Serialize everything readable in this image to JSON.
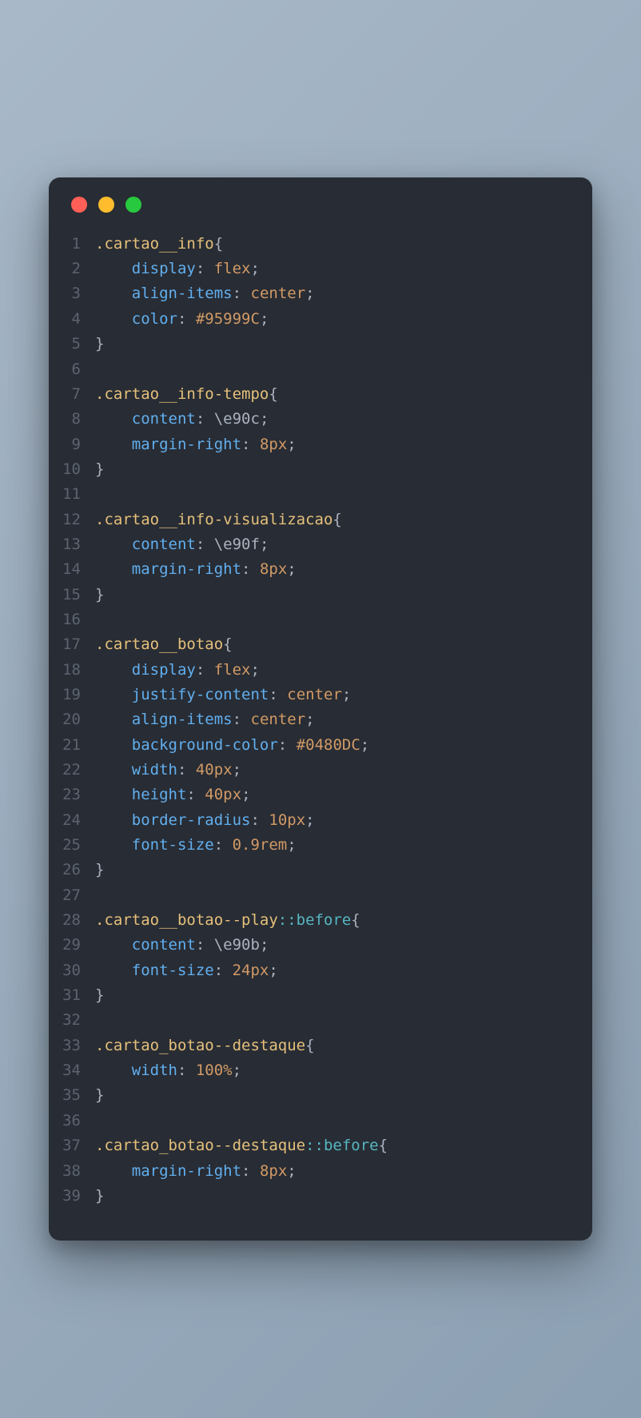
{
  "window": {
    "dots": [
      "red",
      "yellow",
      "green"
    ]
  },
  "lines": [
    {
      "n": "1",
      "i": 0,
      "t": [
        {
          "c": "sel",
          "s": ".cartao__info"
        },
        {
          "c": "punc",
          "s": "{"
        }
      ]
    },
    {
      "n": "2",
      "i": 1,
      "t": [
        {
          "c": "prop",
          "s": "display"
        },
        {
          "c": "punc",
          "s": ": "
        },
        {
          "c": "val",
          "s": "flex"
        },
        {
          "c": "punc",
          "s": ";"
        }
      ]
    },
    {
      "n": "3",
      "i": 1,
      "t": [
        {
          "c": "prop",
          "s": "align-items"
        },
        {
          "c": "punc",
          "s": ": "
        },
        {
          "c": "val",
          "s": "center"
        },
        {
          "c": "punc",
          "s": ";"
        }
      ]
    },
    {
      "n": "4",
      "i": 1,
      "t": [
        {
          "c": "prop",
          "s": "color"
        },
        {
          "c": "punc",
          "s": ": "
        },
        {
          "c": "val",
          "s": "#95999C"
        },
        {
          "c": "punc",
          "s": ";"
        }
      ]
    },
    {
      "n": "5",
      "i": 0,
      "t": [
        {
          "c": "punc",
          "s": "}"
        }
      ]
    },
    {
      "n": "6",
      "i": 0,
      "t": []
    },
    {
      "n": "7",
      "i": 0,
      "t": [
        {
          "c": "sel",
          "s": ".cartao__info-tempo"
        },
        {
          "c": "punc",
          "s": "{"
        }
      ]
    },
    {
      "n": "8",
      "i": 1,
      "t": [
        {
          "c": "prop",
          "s": "content"
        },
        {
          "c": "punc",
          "s": ": "
        },
        {
          "c": "plain",
          "s": "\\e90c"
        },
        {
          "c": "punc",
          "s": ";"
        }
      ]
    },
    {
      "n": "9",
      "i": 1,
      "t": [
        {
          "c": "prop",
          "s": "margin-right"
        },
        {
          "c": "punc",
          "s": ": "
        },
        {
          "c": "val",
          "s": "8px"
        },
        {
          "c": "punc",
          "s": ";"
        }
      ]
    },
    {
      "n": "10",
      "i": 0,
      "t": [
        {
          "c": "punc",
          "s": "}"
        }
      ]
    },
    {
      "n": "11",
      "i": 0,
      "t": []
    },
    {
      "n": "12",
      "i": 0,
      "t": [
        {
          "c": "sel",
          "s": ".cartao__info-visualizacao"
        },
        {
          "c": "punc",
          "s": "{"
        }
      ]
    },
    {
      "n": "13",
      "i": 1,
      "t": [
        {
          "c": "prop",
          "s": "content"
        },
        {
          "c": "punc",
          "s": ": "
        },
        {
          "c": "plain",
          "s": "\\e90f"
        },
        {
          "c": "punc",
          "s": ";"
        }
      ]
    },
    {
      "n": "14",
      "i": 1,
      "t": [
        {
          "c": "prop",
          "s": "margin-right"
        },
        {
          "c": "punc",
          "s": ": "
        },
        {
          "c": "val",
          "s": "8px"
        },
        {
          "c": "punc",
          "s": ";"
        }
      ]
    },
    {
      "n": "15",
      "i": 0,
      "t": [
        {
          "c": "punc",
          "s": "}"
        }
      ]
    },
    {
      "n": "16",
      "i": 0,
      "t": []
    },
    {
      "n": "17",
      "i": 0,
      "t": [
        {
          "c": "sel",
          "s": ".cartao__botao"
        },
        {
          "c": "punc",
          "s": "{"
        }
      ]
    },
    {
      "n": "18",
      "i": 1,
      "t": [
        {
          "c": "prop",
          "s": "display"
        },
        {
          "c": "punc",
          "s": ": "
        },
        {
          "c": "val",
          "s": "flex"
        },
        {
          "c": "punc",
          "s": ";"
        }
      ]
    },
    {
      "n": "19",
      "i": 1,
      "t": [
        {
          "c": "prop",
          "s": "justify-content"
        },
        {
          "c": "punc",
          "s": ": "
        },
        {
          "c": "val",
          "s": "center"
        },
        {
          "c": "punc",
          "s": ";"
        }
      ]
    },
    {
      "n": "20",
      "i": 1,
      "t": [
        {
          "c": "prop",
          "s": "align-items"
        },
        {
          "c": "punc",
          "s": ": "
        },
        {
          "c": "val",
          "s": "center"
        },
        {
          "c": "punc",
          "s": ";"
        }
      ]
    },
    {
      "n": "21",
      "i": 1,
      "t": [
        {
          "c": "prop",
          "s": "background-color"
        },
        {
          "c": "punc",
          "s": ": "
        },
        {
          "c": "val",
          "s": "#0480DC"
        },
        {
          "c": "punc",
          "s": ";"
        }
      ]
    },
    {
      "n": "22",
      "i": 1,
      "t": [
        {
          "c": "prop",
          "s": "width"
        },
        {
          "c": "punc",
          "s": ": "
        },
        {
          "c": "val",
          "s": "40px"
        },
        {
          "c": "punc",
          "s": ";"
        }
      ]
    },
    {
      "n": "23",
      "i": 1,
      "t": [
        {
          "c": "prop",
          "s": "height"
        },
        {
          "c": "punc",
          "s": ": "
        },
        {
          "c": "val",
          "s": "40px"
        },
        {
          "c": "punc",
          "s": ";"
        }
      ]
    },
    {
      "n": "24",
      "i": 1,
      "t": [
        {
          "c": "prop",
          "s": "border-radius"
        },
        {
          "c": "punc",
          "s": ": "
        },
        {
          "c": "val",
          "s": "10px"
        },
        {
          "c": "punc",
          "s": ";"
        }
      ]
    },
    {
      "n": "25",
      "i": 1,
      "t": [
        {
          "c": "prop",
          "s": "font-size"
        },
        {
          "c": "punc",
          "s": ": "
        },
        {
          "c": "val",
          "s": "0.9rem"
        },
        {
          "c": "punc",
          "s": ";"
        }
      ]
    },
    {
      "n": "26",
      "i": 0,
      "t": [
        {
          "c": "punc",
          "s": "}"
        }
      ]
    },
    {
      "n": "27",
      "i": 0,
      "t": []
    },
    {
      "n": "28",
      "i": 0,
      "t": [
        {
          "c": "sel",
          "s": ".cartao__botao--play"
        },
        {
          "c": "valc",
          "s": "::before"
        },
        {
          "c": "punc",
          "s": "{"
        }
      ]
    },
    {
      "n": "29",
      "i": 1,
      "t": [
        {
          "c": "prop",
          "s": "content"
        },
        {
          "c": "punc",
          "s": ": "
        },
        {
          "c": "plain",
          "s": "\\e90b"
        },
        {
          "c": "punc",
          "s": ";"
        }
      ]
    },
    {
      "n": "30",
      "i": 1,
      "t": [
        {
          "c": "prop",
          "s": "font-size"
        },
        {
          "c": "punc",
          "s": ": "
        },
        {
          "c": "val",
          "s": "24px"
        },
        {
          "c": "punc",
          "s": ";"
        }
      ]
    },
    {
      "n": "31",
      "i": 0,
      "t": [
        {
          "c": "punc",
          "s": "}"
        }
      ]
    },
    {
      "n": "32",
      "i": 0,
      "t": []
    },
    {
      "n": "33",
      "i": 0,
      "t": [
        {
          "c": "sel",
          "s": ".cartao_botao--destaque"
        },
        {
          "c": "punc",
          "s": "{"
        }
      ]
    },
    {
      "n": "34",
      "i": 1,
      "t": [
        {
          "c": "prop",
          "s": "width"
        },
        {
          "c": "punc",
          "s": ": "
        },
        {
          "c": "val",
          "s": "100%"
        },
        {
          "c": "punc",
          "s": ";"
        }
      ]
    },
    {
      "n": "35",
      "i": 0,
      "t": [
        {
          "c": "punc",
          "s": "}"
        }
      ]
    },
    {
      "n": "36",
      "i": 0,
      "t": []
    },
    {
      "n": "37",
      "i": 0,
      "t": [
        {
          "c": "sel",
          "s": ".cartao_botao--destaque"
        },
        {
          "c": "valc",
          "s": "::before"
        },
        {
          "c": "punc",
          "s": "{"
        }
      ]
    },
    {
      "n": "38",
      "i": 1,
      "t": [
        {
          "c": "prop",
          "s": "margin-right"
        },
        {
          "c": "punc",
          "s": ": "
        },
        {
          "c": "val",
          "s": "8px"
        },
        {
          "c": "punc",
          "s": ";"
        }
      ]
    },
    {
      "n": "39",
      "i": 0,
      "t": [
        {
          "c": "punc",
          "s": "}"
        }
      ]
    }
  ]
}
